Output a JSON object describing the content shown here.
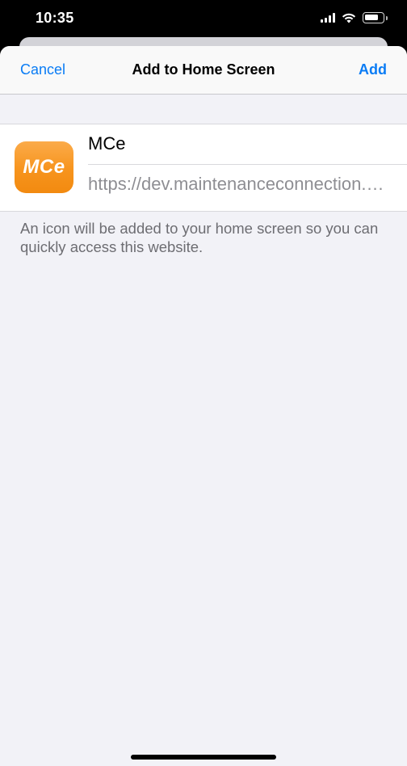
{
  "status_bar": {
    "time": "10:35",
    "icons": [
      "cellular-signal-icon",
      "wifi-icon",
      "battery-icon"
    ]
  },
  "nav": {
    "cancel_label": "Cancel",
    "title": "Add to Home Screen",
    "add_label": "Add"
  },
  "bookmark": {
    "icon_text": "MCe",
    "name": "MCe",
    "url": "https://dev.maintenanceconnection.com"
  },
  "hint_text": "An icon will be added to your home screen so you can quickly access this website.",
  "colors": {
    "accent": "#0a7cf5",
    "icon_orange": "#f7941d",
    "background": "#f2f2f7"
  }
}
